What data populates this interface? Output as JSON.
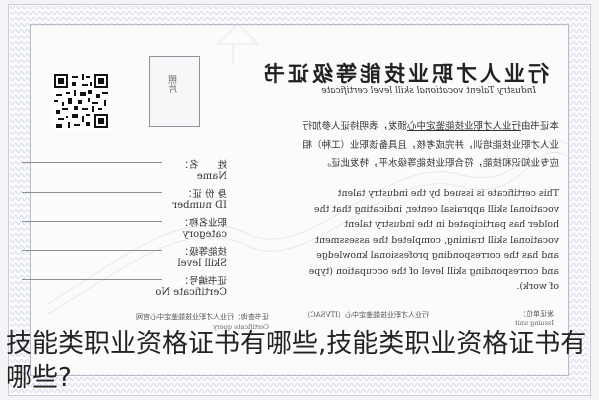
{
  "certificate": {
    "title_cn": "行业人才职业技能等级证书",
    "title_en": "Industry Talent vocational skill level certificate",
    "photo_text": "照片",
    "body_cn_prefix": "本证书由",
    "body_cn_issuer": "行业人才职业技能鉴定中心",
    "body_cn_rest": "颁发，表明持证人参加行业人才职业技能培训，并完成考核，且具备该职业（工种）相应专业知识和技能，符合职业技能等级水平，特发此证。",
    "body_en": "This certificate is issued by the industry talent vocational skill appraisal center, indicating that the holder has participated in the industry talent vocational skill training, completed the assessment and has the corresponding professional knowledge and corresponding skill level of the occupation (type of work).",
    "fields": [
      {
        "cn": "姓　　名：",
        "en": "Name"
      },
      {
        "cn": "身 份 证：",
        "en": "ID number"
      },
      {
        "cn": "职业名称：",
        "en": "category"
      },
      {
        "cn": "技能等级：",
        "en": "Skill level"
      },
      {
        "cn": "证书编号：",
        "en": "Certificate No"
      }
    ],
    "footer_left_cn": "证书查询：行业人才职业技能鉴定中心官网",
    "footer_left_en": "Certificate query",
    "footer_mid": "行业人才职业技能鉴定中心（ITVSAC）",
    "footer_right_cn": "发证单位：",
    "footer_right_en": "Issuing unit"
  },
  "caption": "技能类职业资格证书有哪些,技能类职业资格证书有哪些?",
  "colors": {
    "paper": "#fbfbfc",
    "guilloche": "#c8cbe0",
    "ink": "#333333"
  }
}
